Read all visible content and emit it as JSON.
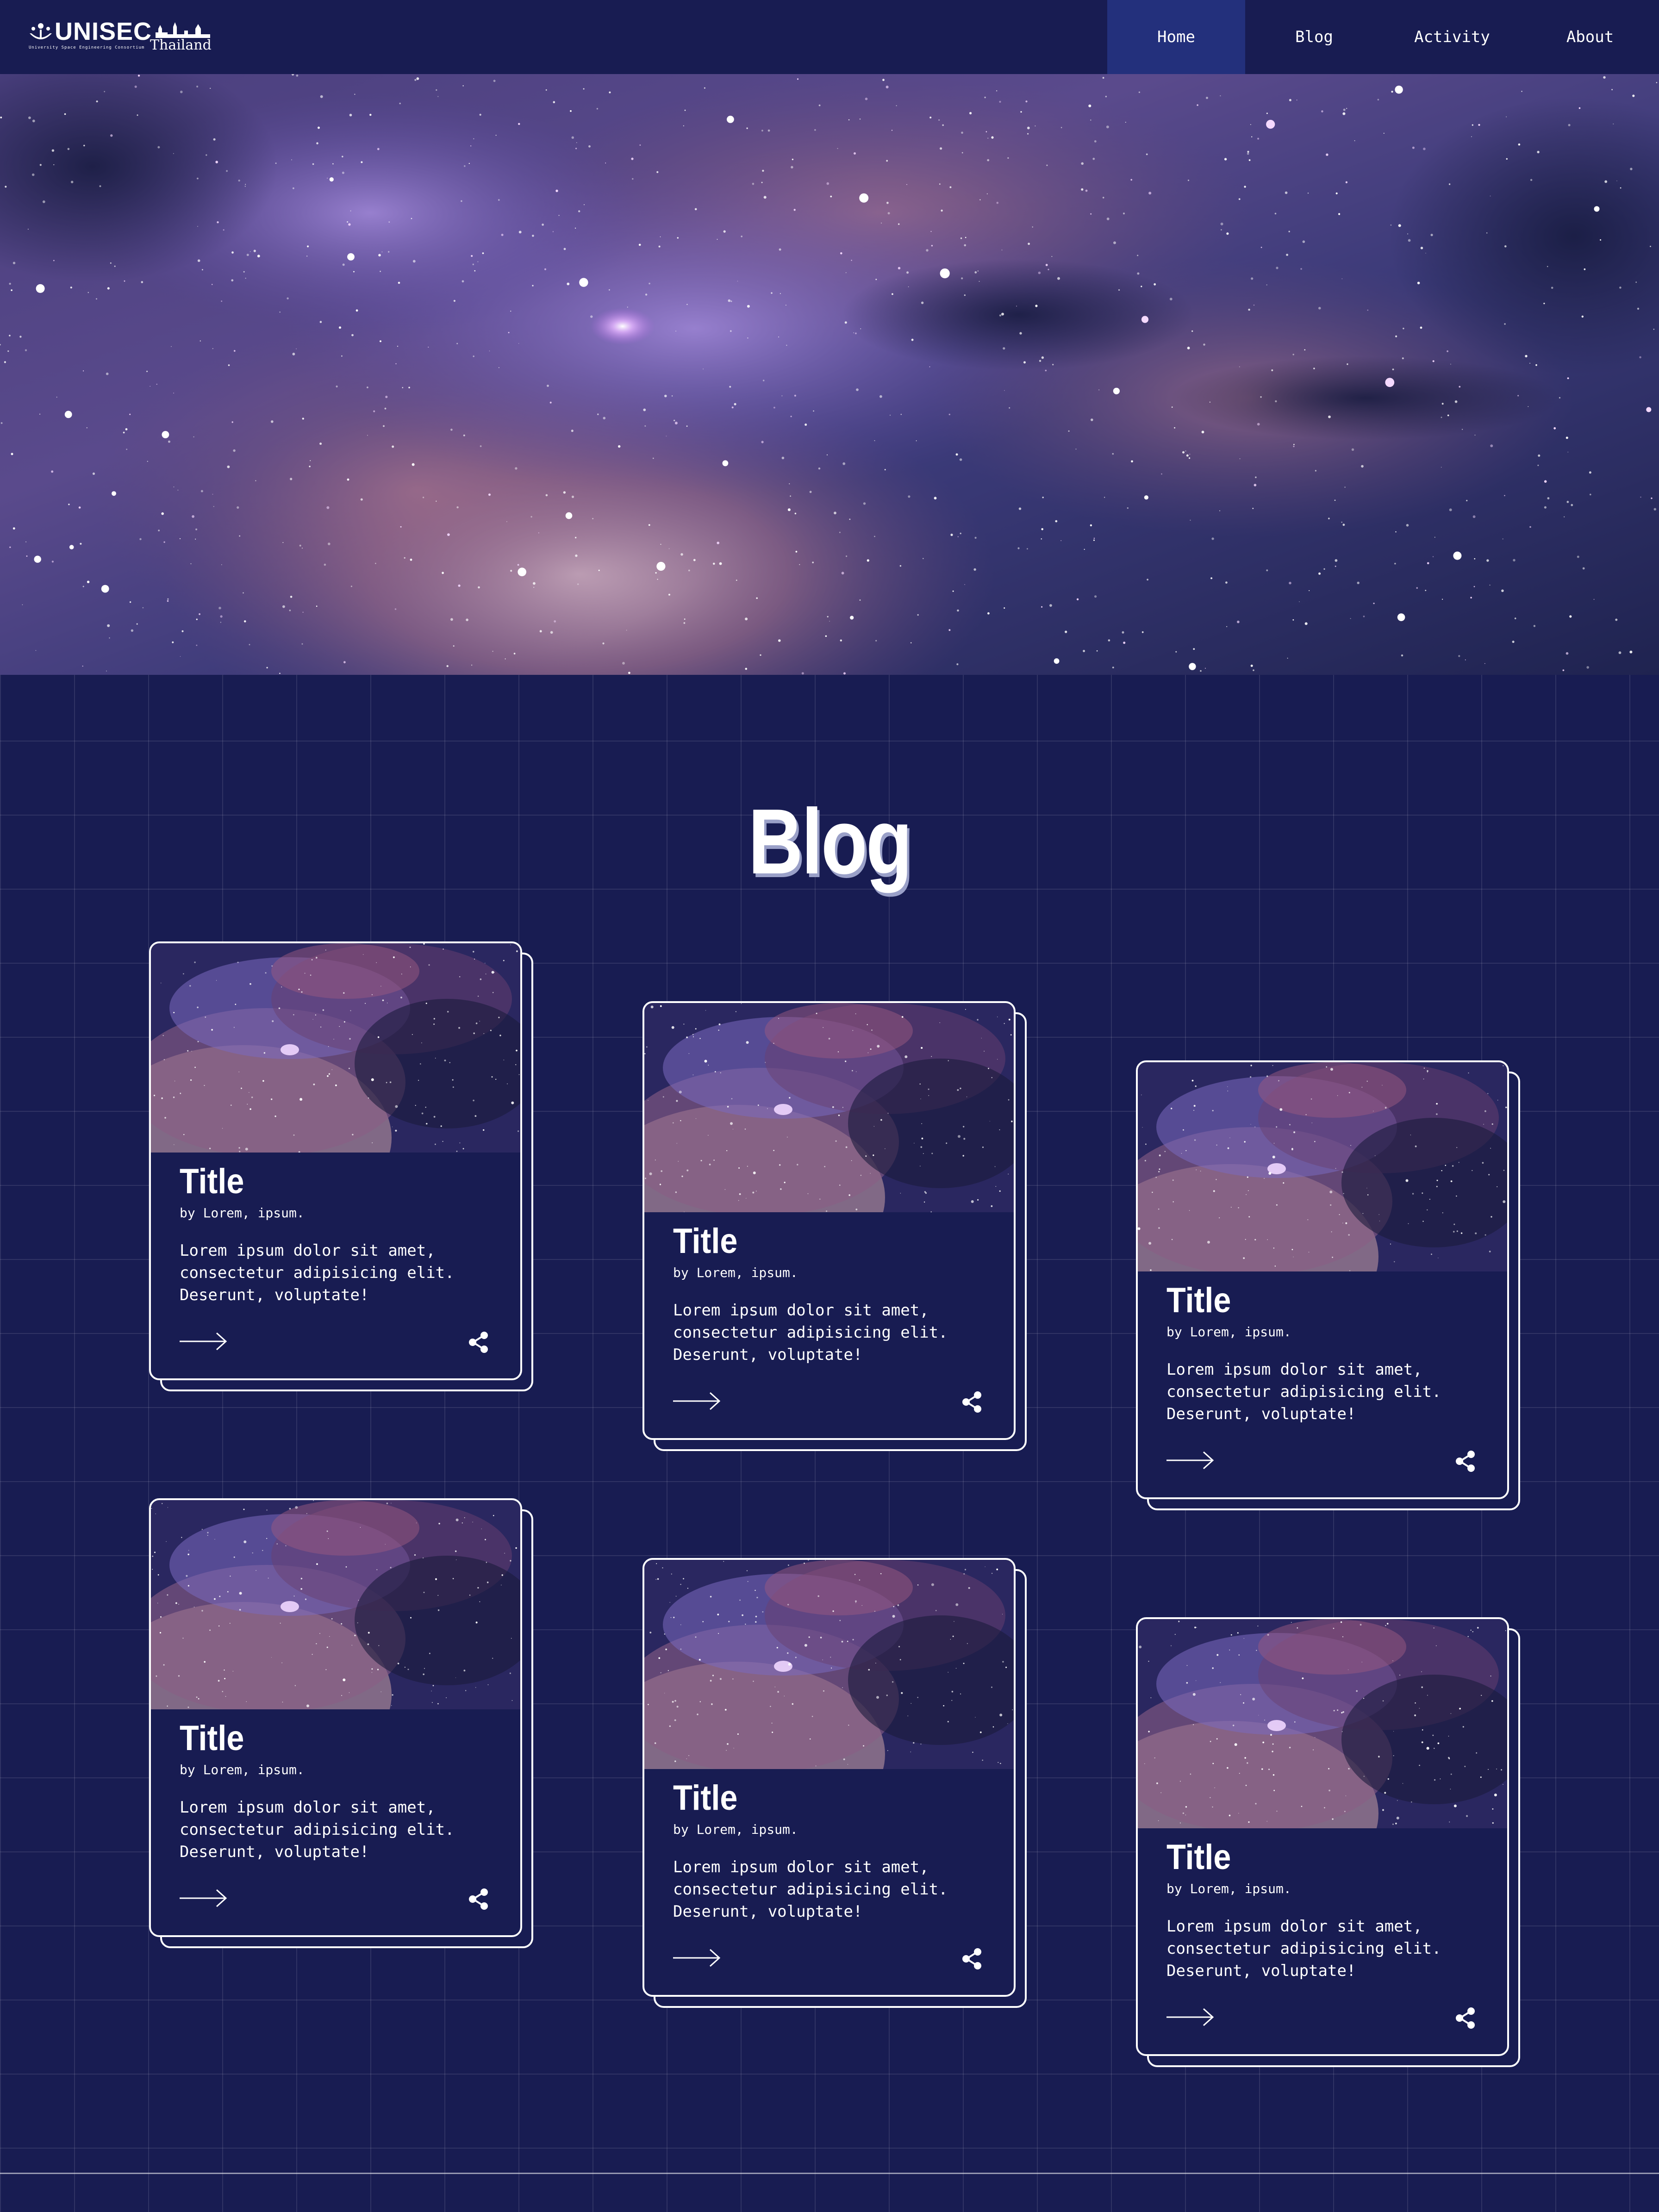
{
  "nav": {
    "logo": {
      "name": "UNISEC",
      "tagline": "University Space Engineering Consortium",
      "sub": "Thailand",
      "icon": "unisec-logo-icon"
    },
    "items": [
      {
        "label": "Home",
        "active": true
      },
      {
        "label": "Blog",
        "active": false
      },
      {
        "label": "Activity",
        "active": false
      },
      {
        "label": "About",
        "active": false
      }
    ]
  },
  "hero": {
    "image": "milky-way-starfield"
  },
  "section": {
    "title": "Blog"
  },
  "cards": [
    {
      "title": "Title",
      "author": "by Lorem, ipsum.",
      "body": "Lorem ipsum dolor sit amet, consectetur adipisicing elit. Deserunt, voluptate!",
      "image": "milky-way-thumbnail",
      "arrow_icon": "arrow-right-icon",
      "share_icon": "share-icon"
    },
    {
      "title": "Title",
      "author": "by Lorem, ipsum.",
      "body": "Lorem ipsum dolor sit amet, consectetur adipisicing elit. Deserunt, voluptate!",
      "image": "milky-way-thumbnail",
      "arrow_icon": "arrow-right-icon",
      "share_icon": "share-icon"
    },
    {
      "title": "Title",
      "author": "by Lorem, ipsum.",
      "body": "Lorem ipsum dolor sit amet, consectetur adipisicing elit. Deserunt, voluptate!",
      "image": "milky-way-thumbnail",
      "arrow_icon": "arrow-right-icon",
      "share_icon": "share-icon"
    },
    {
      "title": "Title",
      "author": "by Lorem, ipsum.",
      "body": "Lorem ipsum dolor sit amet, consectetur adipisicing elit. Deserunt, voluptate!",
      "image": "milky-way-thumbnail",
      "arrow_icon": "arrow-right-icon",
      "share_icon": "share-icon"
    },
    {
      "title": "Title",
      "author": "by Lorem, ipsum.",
      "body": "Lorem ipsum dolor sit amet, consectetur adipisicing elit. Deserunt, voluptate!",
      "image": "milky-way-thumbnail",
      "arrow_icon": "arrow-right-icon",
      "share_icon": "share-icon"
    },
    {
      "title": "Title",
      "author": "by Lorem, ipsum.",
      "body": "Lorem ipsum dolor sit amet, consectetur adipisicing elit. Deserunt, voluptate!",
      "image": "milky-way-thumbnail",
      "arrow_icon": "arrow-right-icon",
      "share_icon": "share-icon"
    }
  ],
  "colors": {
    "background": "#181c52",
    "nav_active": "#23307c",
    "text": "#ffffff",
    "card_border": "#ffffff"
  }
}
